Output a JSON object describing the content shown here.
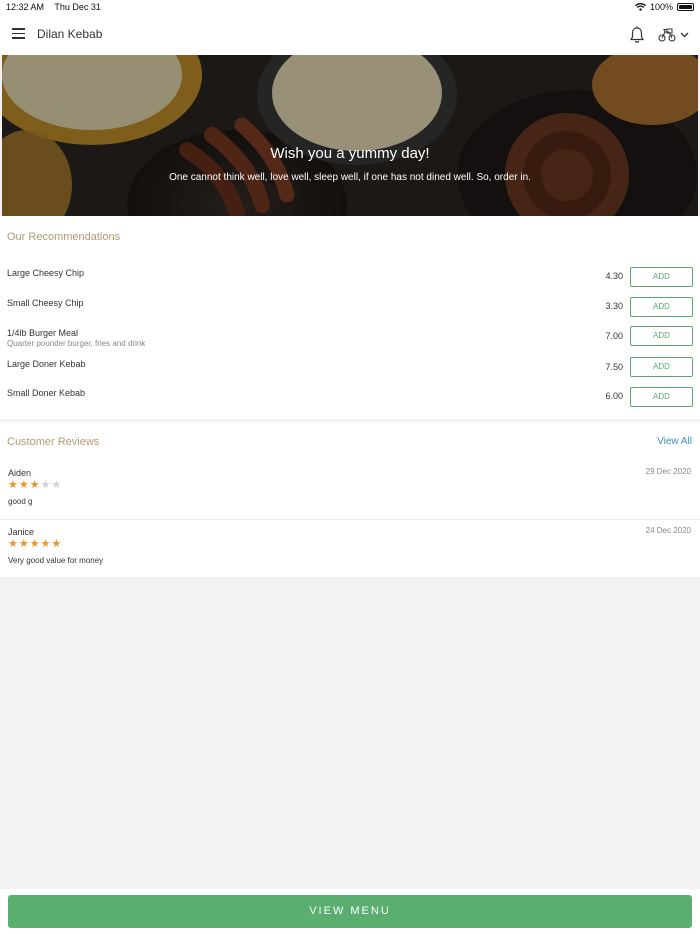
{
  "status_bar": {
    "time": "12:32 AM",
    "date": "Thu Dec 31",
    "battery": "100%"
  },
  "header": {
    "title": "Dilan Kebab",
    "icons": [
      "menu-icon",
      "bell-icon",
      "delivery-icon",
      "chevron-down-icon"
    ]
  },
  "hero": {
    "title": "Wish you a yummy day!",
    "subtitle": "One cannot think well, love well, sleep well, if one has not dined well. So, order in."
  },
  "recommendations": {
    "title": "Our Recommendations",
    "items": [
      {
        "name": "Large Cheesy Chip",
        "description": "",
        "price": "4.30",
        "action": "ADD"
      },
      {
        "name": "Small Cheesy Chip",
        "description": "",
        "price": "3.30",
        "action": "ADD"
      },
      {
        "name": "1/4lb Burger Meal",
        "description": "Quarter pounder burger, fries and drink",
        "price": "7.00",
        "action": "ADD"
      },
      {
        "name": "Large Doner Kebab",
        "description": "",
        "price": "7.50",
        "action": "ADD"
      },
      {
        "name": "Small Doner Kebab",
        "description": "",
        "price": "6.00",
        "action": "ADD"
      }
    ]
  },
  "reviews": {
    "title": "Customer Reviews",
    "view_all": "View All",
    "items": [
      {
        "name": "Aiden",
        "date": "29 Dec 2020",
        "rating": 3,
        "max_rating": 5,
        "text": "good g"
      },
      {
        "name": "Janice",
        "date": "24 Dec 2020",
        "rating": 5,
        "max_rating": 5,
        "text": "Very good value for money"
      }
    ]
  },
  "footer": {
    "button_label": "VIEW MENU"
  },
  "colors": {
    "accent_green": "#5aae70",
    "section_title": "#b49a72",
    "link_blue": "#3a8fb5",
    "star_on": "#f0932b",
    "star_off": "#d2d2d2"
  }
}
